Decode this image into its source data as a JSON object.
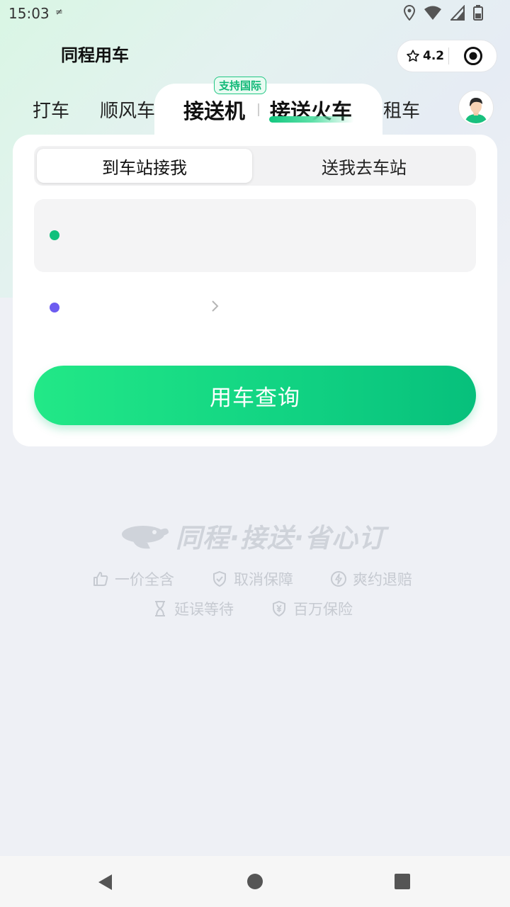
{
  "status_bar": {
    "time": "15:03",
    "icons": [
      "notification-icon",
      "location-icon",
      "wifi-icon",
      "signal-icon",
      "battery-icon"
    ]
  },
  "header": {
    "app_title": "同程用车",
    "rating": "4.2"
  },
  "tabs": {
    "items": [
      "打车",
      "顺风车",
      "接送机",
      "接送火车",
      "租车"
    ],
    "active": "接送火车",
    "badge": "支持国际"
  },
  "card": {
    "segment": {
      "active": "到车站接我",
      "inactive": "送我去车站"
    },
    "pickup_field": {
      "value": ""
    },
    "dropoff_field": {
      "value": ""
    },
    "cta": "用车查询"
  },
  "slogan": {
    "text": "同程·接送·省心订",
    "features": [
      "一价全含",
      "取消保障",
      "爽约退赔",
      "延误等待",
      "百万保险"
    ]
  },
  "colors": {
    "brand_green": "#10c07c",
    "accent_purple": "#6d5cf0",
    "muted": "#c6cad1"
  }
}
